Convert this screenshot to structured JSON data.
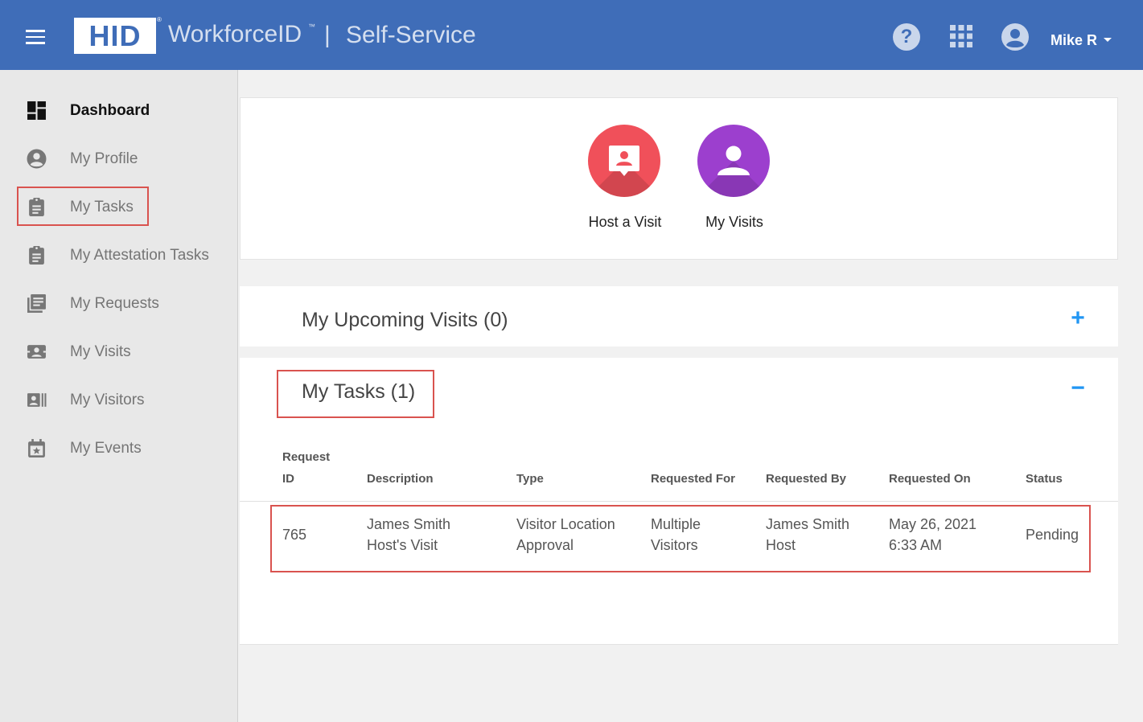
{
  "header": {
    "logo": "HID",
    "logo_reg": "®",
    "product": "WorkforceID",
    "product_tm": "™",
    "separator": "|",
    "service": "Self-Service",
    "help_icon": "help-circle-icon",
    "apps_icon": "apps-grid-icon",
    "account_icon": "account-circle-icon",
    "user": "Mike R"
  },
  "sidebar": {
    "items": [
      {
        "label": "Dashboard",
        "icon": "dashboard-icon"
      },
      {
        "label": "My Profile",
        "icon": "account-circle-icon"
      },
      {
        "label": "My Tasks",
        "icon": "clipboard-icon"
      },
      {
        "label": "My Attestation Tasks",
        "icon": "clipboard-icon"
      },
      {
        "label": "My Requests",
        "icon": "library-books-icon"
      },
      {
        "label": "My Visits",
        "icon": "contact-card-icon"
      },
      {
        "label": "My Visitors",
        "icon": "visitors-icon"
      },
      {
        "label": "My Events",
        "icon": "event-icon"
      }
    ]
  },
  "quick_actions": {
    "host_visit": "Host a Visit",
    "my_visits": "My Visits"
  },
  "upcoming": {
    "title": "My Upcoming Visits (0)",
    "toggle": "+"
  },
  "tasks": {
    "title": "My Tasks (1)",
    "toggle": "−",
    "columns": [
      "Request",
      "ID",
      "Description",
      "Type",
      "Requested For",
      "Requested By",
      "Requested On",
      "Status"
    ],
    "row": {
      "id": "765",
      "description_1": "James Smith",
      "description_2": "Host's Visit",
      "type_1": "Visitor Location",
      "type_2": "Approval",
      "for_1": "Multiple",
      "for_2": "Visitors",
      "by_1": "James Smith",
      "by_2": "Host",
      "on_1": "May 26, 2021",
      "on_2": "6:33 AM",
      "status": "Pending"
    }
  },
  "colors": {
    "header": "#3f6db8",
    "host_button": "#f0505a",
    "visits_button": "#9c3fce",
    "highlight": "#d9534f",
    "accent": "#2196f3"
  }
}
